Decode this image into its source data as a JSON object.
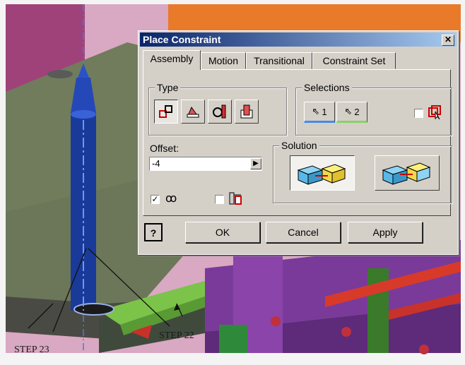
{
  "dialog": {
    "title": "Place Constraint",
    "close_glyph": "✕",
    "tabs": [
      {
        "label": "Assembly",
        "active": true
      },
      {
        "label": "Motion",
        "active": false
      },
      {
        "label": "Transitional",
        "active": false
      },
      {
        "label": "Constraint Set",
        "active": false
      }
    ],
    "type_group": {
      "label": "Type",
      "buttons": [
        {
          "icon": "mate-icon",
          "selected": true
        },
        {
          "icon": "angle-icon",
          "selected": false
        },
        {
          "icon": "tangent-icon",
          "selected": false
        },
        {
          "icon": "insert-icon",
          "selected": false
        }
      ]
    },
    "selections_group": {
      "label": "Selections",
      "select1": "1",
      "select2": "2",
      "pick_part_first_checked": false
    },
    "offset": {
      "label": "Offset:",
      "value": "-4"
    },
    "show_preview_checked": true,
    "predict_offset_checked": false,
    "solution_group": {
      "label": "Solution",
      "options": [
        {
          "icon": "mate-solution-icon",
          "selected": true
        },
        {
          "icon": "flush-solution-icon",
          "selected": false
        }
      ]
    },
    "buttons": {
      "help": "?",
      "ok": "OK",
      "cancel": "Cancel",
      "apply": "Apply"
    }
  },
  "annotations": {
    "step22": "STEP 22",
    "step23": "STEP 23"
  },
  "colors": {
    "titlebar": "#0a246a",
    "dialog_face": "#d4d0c8",
    "plate": "#6b7758",
    "pin": "#1a3a9a",
    "purple_frame": "#7a3a9a",
    "green_bar": "#7cc34a",
    "red_rod": "#d83a2a"
  }
}
